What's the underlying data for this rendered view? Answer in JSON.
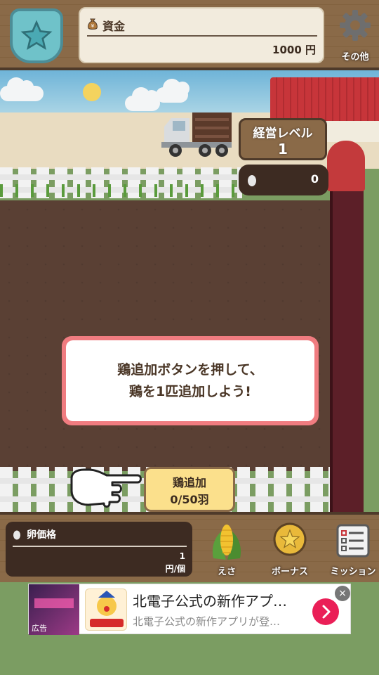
{
  "header": {
    "money_label": "資金",
    "money_value": "1000 円",
    "settings_label": "その他"
  },
  "status": {
    "level_title": "経営レベル",
    "level_value": "1",
    "egg_count": "0"
  },
  "dialog": {
    "line1": "鶏追加ボタンを押して、",
    "line2": "鶏を1匹追加しよう!"
  },
  "add_chicken": {
    "title": "鶏追加",
    "count": "0/50羽"
  },
  "bottom": {
    "egg_price_label": "卵価格",
    "egg_price_value": "1",
    "egg_price_unit": "円/個",
    "feed_label": "えさ",
    "bonus_label": "ボーナス",
    "mission_label": "ミッション"
  },
  "ad": {
    "label": "広告",
    "title": "北電子公式の新作アプ…",
    "subtitle": "北電子公式の新作アプリが登…"
  },
  "colors": {
    "wood": "#8a6a48",
    "dark_wood": "#4e3a2a",
    "badge": "#6fc2c9",
    "dialog_border": "#f07c80",
    "button_yellow": "#fbe08c",
    "ad_accent": "#ea1f57"
  },
  "icons": {
    "rank": "star-shield-icon",
    "money": "money-bag-icon",
    "settings": "gear-icon",
    "egg": "egg-icon",
    "feed": "corn-icon",
    "bonus": "star-coin-icon",
    "mission": "checklist-icon",
    "pointer": "pointing-hand-icon",
    "ad_close": "close-icon",
    "ad_open": "chevron-right-icon"
  }
}
